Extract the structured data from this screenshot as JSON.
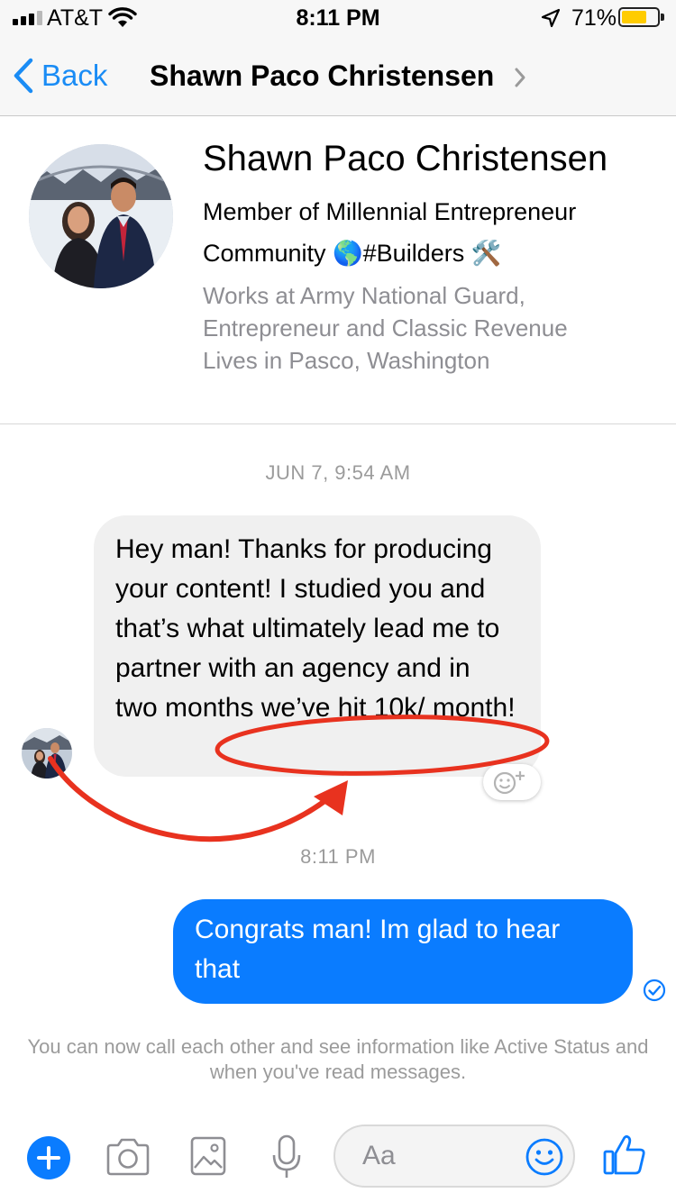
{
  "status_bar": {
    "carrier": "AT&T",
    "time": "8:11 PM",
    "battery_percent": "71%",
    "battery_level": 0.71,
    "battery_color": "#ffcc00"
  },
  "nav": {
    "back_label": "Back",
    "title": "Shawn Paco Christensen",
    "accent_color": "#1a8cf5"
  },
  "profile": {
    "name": "Shawn Paco Christensen",
    "bio_line1": "Member of Millennial Entrepreneur",
    "bio_line2": "Community 🌎#Builders 🛠️",
    "work_line1": "Works at Army National Guard,",
    "work_line2": "Entrepreneur and Classic Revenue",
    "lives_line": "Lives in Pasco, Washington"
  },
  "conversation": {
    "timestamp_1": "JUN 7, 9:54 AM",
    "incoming_message": "Hey man! Thanks for producing your content! I studied you and that’s what ultimately lead me to partner with an agency and in two months we’ve hit 10k/ month!",
    "timestamp_2": "8:11 PM",
    "outgoing_message": "Congrats man! Im glad to hear that",
    "outgoing_color": "#0a7cff",
    "system_message": "You can now call each other and see information like Active Status and when you've read messages.",
    "annotation_color": "#e8321f"
  },
  "composer": {
    "placeholder": "Aa",
    "icons": [
      "plus-icon",
      "camera-icon",
      "photo-icon",
      "microphone-icon",
      "emoji-icon",
      "thumbs-up-icon"
    ]
  }
}
